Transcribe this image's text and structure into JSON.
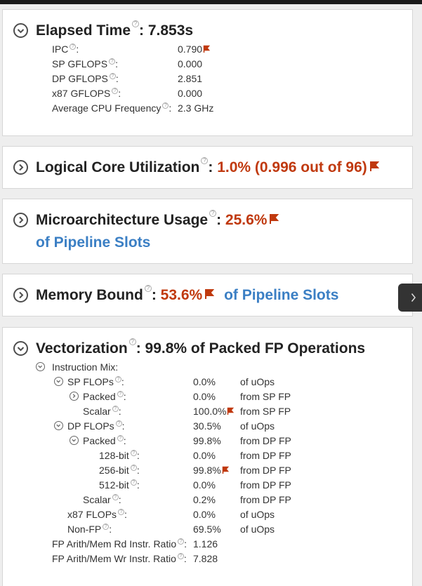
{
  "elapsed": {
    "title": "Elapsed Time",
    "value": "7.853s",
    "metrics": [
      {
        "label": "IPC",
        "value": "0.790",
        "flagged": true
      },
      {
        "label": "SP GFLOPS",
        "value": "0.000",
        "flagged": false
      },
      {
        "label": "DP GFLOPS",
        "value": "2.851",
        "flagged": false
      },
      {
        "label": "x87 GFLOPS",
        "value": "0.000",
        "flagged": false
      },
      {
        "label": "Average CPU Frequency",
        "value": "2.3 GHz",
        "flagged": false
      }
    ]
  },
  "logical": {
    "title": "Logical Core Utilization",
    "value": "1.0% (0.996 out of 96)"
  },
  "micro": {
    "title": "Microarchitecture Usage",
    "value": "25.6%",
    "unit": "of Pipeline Slots"
  },
  "memory": {
    "title": "Memory Bound",
    "value": "53.6%",
    "unit": "of Pipeline Slots"
  },
  "vectorization": {
    "title": "Vectorization",
    "value": "99.8% of Packed FP Operations",
    "instruction_mix_label": "Instruction Mix:",
    "rows": [
      {
        "label": "SP FLOPs",
        "value": "0.0%",
        "unit": "of uOps",
        "unit_link": true,
        "flagged": false,
        "toggle": "expanded"
      },
      {
        "label": "Packed",
        "value": "0.0%",
        "unit": "from SP FP",
        "unit_link": false,
        "flagged": false,
        "toggle": "collapsed"
      },
      {
        "label": "Scalar",
        "value": "100.0%",
        "unit": "from SP FP",
        "unit_link": false,
        "flagged": true,
        "toggle": "none"
      },
      {
        "label": "DP FLOPs",
        "value": "30.5%",
        "unit": "of uOps",
        "unit_link": true,
        "flagged": false,
        "toggle": "expanded"
      },
      {
        "label": "Packed",
        "value": "99.8%",
        "unit": "from DP FP",
        "unit_link": false,
        "flagged": false,
        "toggle": "expanded"
      },
      {
        "label": "128-bit",
        "value": "0.0%",
        "unit": "from DP FP",
        "unit_link": false,
        "flagged": false,
        "toggle": "none"
      },
      {
        "label": "256-bit",
        "value": "99.8%",
        "unit": "from DP FP",
        "unit_link": false,
        "flagged": true,
        "toggle": "none"
      },
      {
        "label": "512-bit",
        "value": "0.0%",
        "unit": "from DP FP",
        "unit_link": false,
        "flagged": false,
        "toggle": "none"
      },
      {
        "label": "Scalar",
        "value": "0.2%",
        "unit": "from DP FP",
        "unit_link": false,
        "flagged": false,
        "toggle": "none"
      },
      {
        "label": "x87 FLOPs",
        "value": "0.0%",
        "unit": "of uOps",
        "unit_link": true,
        "flagged": false,
        "toggle": "none"
      },
      {
        "label": "Non-FP",
        "value": "69.5%",
        "unit": "of uOps",
        "unit_link": true,
        "flagged": false,
        "toggle": "none"
      },
      {
        "label": "FP Arith/Mem Rd Instr. Ratio",
        "value": "1.126",
        "unit": "",
        "unit_link": false,
        "flagged": false,
        "toggle": "none"
      },
      {
        "label": "FP Arith/Mem Wr Instr. Ratio",
        "value": "7.828",
        "unit": "",
        "unit_link": false,
        "flagged": false,
        "toggle": "none"
      }
    ]
  },
  "colors": {
    "flag": "#c0390e",
    "link": "#3b7fc4"
  },
  "icons": {
    "toggle_expanded": "chevron-down-circle-icon",
    "toggle_collapsed": "chevron-right-circle-icon",
    "help": "question-mark-icon",
    "flag": "red-flag-icon",
    "side_panel": "chevron-right-icon"
  }
}
